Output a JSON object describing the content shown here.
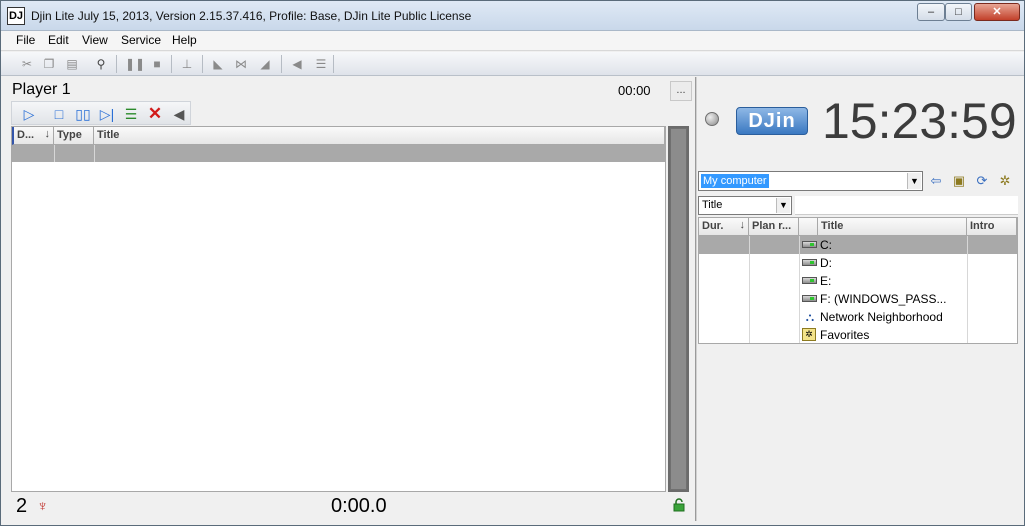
{
  "window": {
    "title": "Djin Lite July 15, 2013, Version 2.15.37.416,  Profile: Base, DJin Lite Public License",
    "app_icon_text": "DJ",
    "minimize": "–",
    "maximize": "□",
    "close": "✕"
  },
  "menu": {
    "items": [
      "File",
      "Edit",
      "View",
      "Service",
      "Help"
    ]
  },
  "toolbar": {
    "icons": [
      "cut-icon",
      "copy-icon",
      "paste-icon",
      "find-icon",
      "pause-all-icon",
      "stop-all-icon",
      "underline-icon",
      "fade-in-icon",
      "fade-cross-icon",
      "fade-out-icon",
      "volume-icon",
      "list-icon"
    ]
  },
  "player": {
    "title": "Player 1",
    "time": "00:00",
    "more_button": "...",
    "columns": [
      "D...",
      "Type",
      "Title"
    ],
    "count": "2",
    "timer": "0:00.0",
    "controls": [
      "play-icon",
      "stop-icon",
      "pause-icon",
      "next-icon",
      "stack-icon",
      "delete-icon",
      "volume-icon"
    ]
  },
  "browser": {
    "clock": "15:23:59",
    "logo_text": "DJin",
    "path_value": "My computer",
    "sort_value": "Title",
    "columns": [
      "Dur.",
      "Plan r...",
      "",
      "Title",
      "Intro"
    ],
    "items": [
      {
        "icon": "drive-icon",
        "label": "C:",
        "selected": true
      },
      {
        "icon": "drive-icon",
        "label": "D:",
        "selected": false
      },
      {
        "icon": "drive-icon",
        "label": "E:",
        "selected": false
      },
      {
        "icon": "drive-icon",
        "label": "F: (WINDOWS_PASS...",
        "selected": false
      },
      {
        "icon": "network-icon",
        "label": "Network Neighborhood",
        "selected": false
      },
      {
        "icon": "favorites-icon",
        "label": "Favorites",
        "selected": false
      }
    ]
  },
  "colors": {
    "selection": "#a9a9a9",
    "accent": "#3399ff",
    "delete": "#d11a1a",
    "play": "#2a6fd6"
  }
}
